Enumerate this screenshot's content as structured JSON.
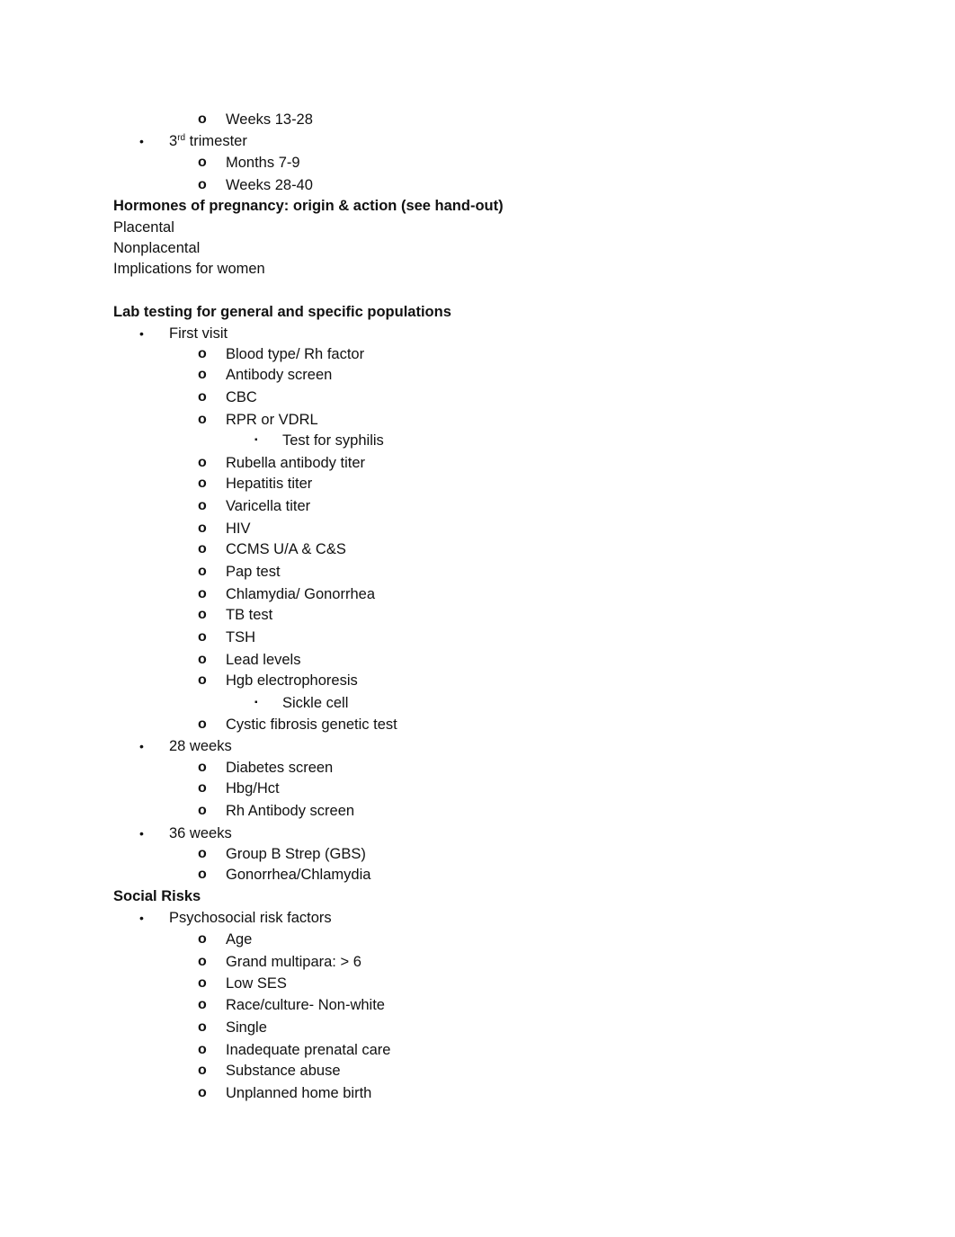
{
  "document": {
    "lines": [
      {
        "level": 2,
        "bullet": "o",
        "text": "Weeks 13-28"
      },
      {
        "level": 1,
        "bullet": "•",
        "text_pre": "3",
        "sup": "rd",
        "text": " trimester"
      },
      {
        "level": 2,
        "bullet": "o",
        "text": "Months 7-9"
      },
      {
        "level": 2,
        "bullet": "o",
        "text": "Weeks 28-40"
      },
      {
        "level": 0,
        "style": "heading",
        "text": "Hormones of pregnancy: origin & action (see hand-out)"
      },
      {
        "level": 0,
        "style": "plain",
        "text": "Placental"
      },
      {
        "level": 0,
        "style": "plain",
        "text": "Nonplacental"
      },
      {
        "level": 0,
        "style": "plain",
        "text": "Implications for women"
      },
      {
        "level": 0,
        "style": "heading",
        "text": "Lab testing for general and specific populations"
      },
      {
        "level": 1,
        "bullet": "•",
        "text": "First visit"
      },
      {
        "level": 2,
        "bullet": "o",
        "text": "Blood type/ Rh factor"
      },
      {
        "level": 2,
        "bullet": "o",
        "text": "Antibody screen"
      },
      {
        "level": 2,
        "bullet": "o",
        "text": "CBC"
      },
      {
        "level": 2,
        "bullet": "o",
        "text": "RPR or VDRL"
      },
      {
        "level": 3,
        "bullet": "▪",
        "text": "Test for syphilis"
      },
      {
        "level": 2,
        "bullet": "o",
        "text": "Rubella antibody titer"
      },
      {
        "level": 2,
        "bullet": "o",
        "text": "Hepatitis titer"
      },
      {
        "level": 2,
        "bullet": "o",
        "text": "Varicella titer"
      },
      {
        "level": 2,
        "bullet": "o",
        "text": "HIV"
      },
      {
        "level": 2,
        "bullet": "o",
        "text": "CCMS U/A & C&S"
      },
      {
        "level": 2,
        "bullet": "o",
        "text": "Pap test"
      },
      {
        "level": 2,
        "bullet": "o",
        "text": "Chlamydia/ Gonorrhea"
      },
      {
        "level": 2,
        "bullet": "o",
        "text": "TB test"
      },
      {
        "level": 2,
        "bullet": "o",
        "text": "TSH"
      },
      {
        "level": 2,
        "bullet": "o",
        "text": "Lead levels"
      },
      {
        "level": 2,
        "bullet": "o",
        "text": "Hgb electrophoresis"
      },
      {
        "level": 3,
        "bullet": "▪",
        "text": "Sickle cell"
      },
      {
        "level": 2,
        "bullet": "o",
        "text": "Cystic fibrosis genetic test"
      },
      {
        "level": 1,
        "bullet": "•",
        "text": "28 weeks"
      },
      {
        "level": 2,
        "bullet": "o",
        "text": "Diabetes screen"
      },
      {
        "level": 2,
        "bullet": "o",
        "text": "Hbg/Hct"
      },
      {
        "level": 2,
        "bullet": "o",
        "text": "Rh Antibody screen"
      },
      {
        "level": 1,
        "bullet": "•",
        "text": "36 weeks"
      },
      {
        "level": 2,
        "bullet": "o",
        "text": "Group B Strep (GBS)"
      },
      {
        "level": 2,
        "bullet": "o",
        "text": "Gonorrhea/Chlamydia"
      },
      {
        "level": 0,
        "style": "heading",
        "text": "Social Risks"
      },
      {
        "level": 1,
        "bullet": "•",
        "text": "Psychosocial risk factors"
      },
      {
        "level": 2,
        "bullet": "o",
        "text": "Age"
      },
      {
        "level": 2,
        "bullet": "o",
        "text": "Grand multipara: > 6"
      },
      {
        "level": 2,
        "bullet": "o",
        "text": "Low SES"
      },
      {
        "level": 2,
        "bullet": "o",
        "text": "Race/culture- Non-white"
      },
      {
        "level": 2,
        "bullet": "o",
        "text": "Single"
      },
      {
        "level": 2,
        "bullet": "o",
        "text": "Inadequate prenatal care"
      },
      {
        "level": 2,
        "bullet": "o",
        "text": "Substance abuse"
      },
      {
        "level": 2,
        "bullet": "o",
        "text": "Unplanned home birth"
      }
    ]
  }
}
